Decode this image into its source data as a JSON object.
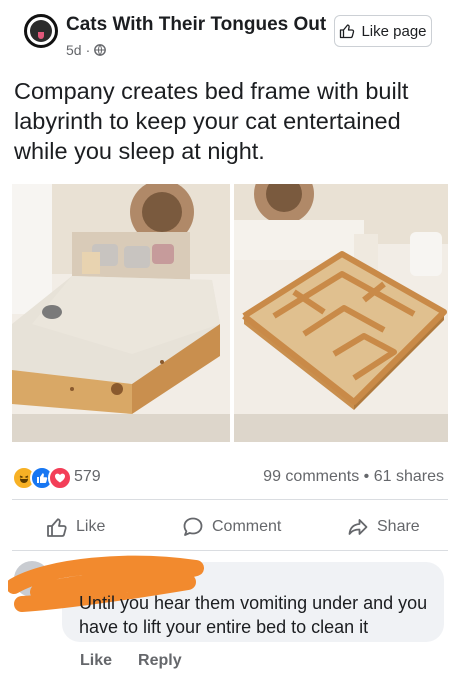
{
  "header": {
    "page_name": "Cats With Their Tongues Out",
    "post_time": "5d",
    "separator": "·",
    "like_page_label": "Like page"
  },
  "post": {
    "text": "Company creates bed frame with built labyrinth to keep your cat entertained while you sleep at night."
  },
  "reactions": {
    "icons": [
      "haha-icon",
      "like-icon",
      "love-icon"
    ],
    "count": "579",
    "comments": "99 comments",
    "bullet": "•",
    "shares": "61 shares"
  },
  "actions": {
    "like_label": "Like",
    "comment_label": "Comment",
    "share_label": "Share"
  },
  "comment": {
    "text": "Until you hear them vomiting under and you have to lift your entire bed to clean it",
    "like_label": "Like",
    "reply_label": "Reply"
  },
  "colors": {
    "text": "#1c1e21",
    "secondary": "#65676b",
    "like_blue": "#1877f2",
    "love_red": "#f33e58",
    "haha_yellow": "#f7b125",
    "redaction_orange": "#f28a2e",
    "comment_bg": "#f0f2f5"
  }
}
